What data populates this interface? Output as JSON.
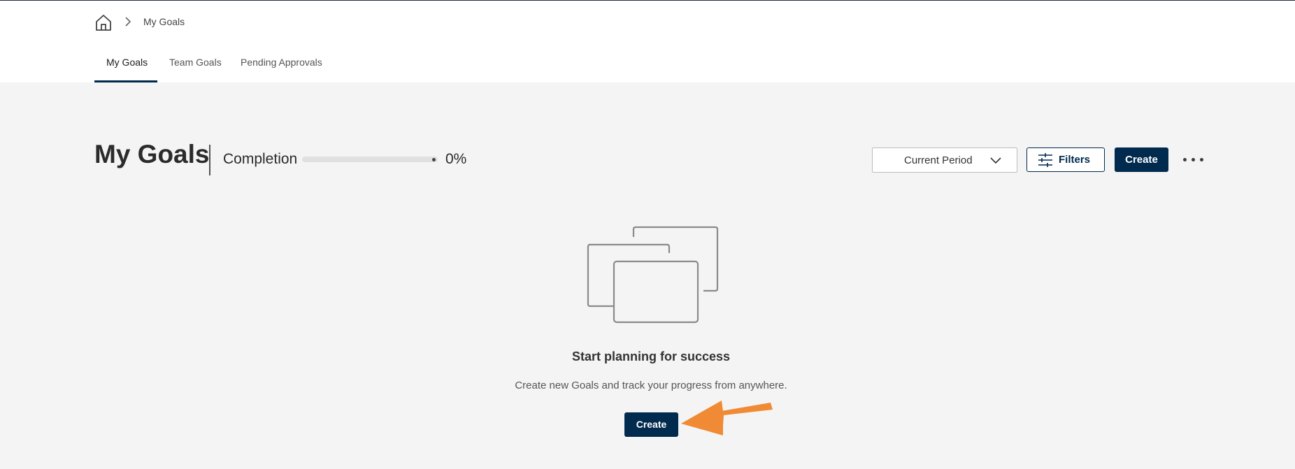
{
  "breadcrumb": {
    "home_icon": "home-icon",
    "separator_icon": "chevron-right-icon",
    "current": "My Goals"
  },
  "tabs": [
    {
      "label": "My Goals",
      "active": true
    },
    {
      "label": "Team Goals",
      "active": false
    },
    {
      "label": "Pending Approvals",
      "active": false
    }
  ],
  "main": {
    "title": "My Goals",
    "completion": {
      "label": "Completion",
      "value_text": "0%",
      "progress_fraction": 0
    },
    "toolbar": {
      "period": "Current Period",
      "filters_label": "Filters",
      "create_label": "Create",
      "more_icon": "more-horizontal-icon"
    },
    "empty_state": {
      "illustration_icon": "stacked-cards-icon",
      "title": "Start planning for success",
      "subtitle": "Create new Goals and track your progress from anywhere.",
      "create_label": "Create"
    }
  },
  "colors": {
    "primary": "#002a4e",
    "background": "#f4f4f4",
    "header": "#ffffff",
    "annotation_arrow": "#f08a34"
  }
}
